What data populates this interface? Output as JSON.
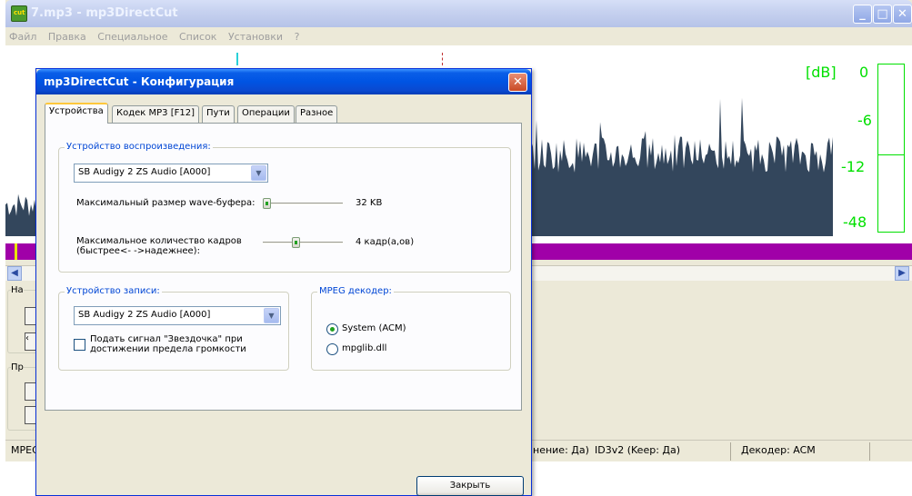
{
  "main": {
    "title": "7.mp3 - mp3DirectCut",
    "menu": [
      "Файл",
      "Правка",
      "Специальное",
      "Список",
      "Установки",
      "?"
    ],
    "meter": {
      "db_label": "[dB]",
      "levels": [
        "0",
        "-6",
        "-12",
        "-48"
      ]
    },
    "left_panel": {
      "top_label": "На",
      "bottom_label": "Пр"
    },
    "status": {
      "mpeg": "MPEG",
      "save": "нение: Да)",
      "id3": "ID3v2 (Keep: Да)",
      "decoder": "Декодер: ACM"
    }
  },
  "dialog": {
    "title": "mp3DirectCut - Конфигурация",
    "tabs": [
      "Устройства",
      "Кодек MP3 [F12]",
      "Пути",
      "Операции",
      "Разное"
    ],
    "playback": {
      "group_title": "Устройство воспроизведения:",
      "device": "SB Audigy 2 ZS Audio [A000]",
      "buffer_label": "Максимальный размер wave-буфера:",
      "buffer_value": "32 KB",
      "frames_label_1": "Максимальное количество кадров",
      "frames_label_2": "(быстрее<- ->надежнее):",
      "frames_value": "4 кадр(а,ов)",
      "buffer_slider_level": 0.0,
      "frames_slider_level": 0.4
    },
    "record": {
      "group_title": "Устройство записи:",
      "device": "SB Audigy 2 ZS Audio [A000]",
      "star_signal_1": "Подать сигнал \"Звездочка\" при",
      "star_signal_2": "достижении предела громкости",
      "star_signal_checked": false
    },
    "decoder": {
      "group_title": "MPEG декодер:",
      "options": [
        "System (ACM)",
        "mpglib.dll"
      ],
      "selected": "System (ACM)"
    },
    "close_label": "Закрыть"
  },
  "colors": {
    "waveform": "#33465c",
    "meter": "#00e000",
    "marker": "#a000a8",
    "dialog_title": "#0054e3"
  }
}
